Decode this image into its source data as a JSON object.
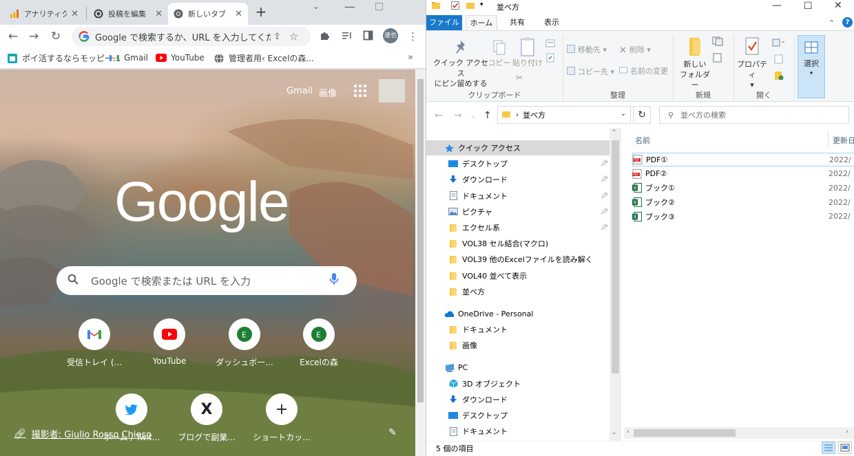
{
  "chrome": {
    "tabs": [
      {
        "label": "アナリティクス",
        "icon": "analytics-icon"
      },
      {
        "label": "投稿を編集",
        "icon": "wordpress-icon"
      },
      {
        "label": "新しいタブ",
        "icon": "chrome-icon",
        "active": true
      }
    ],
    "new_tab_label": "+",
    "omnibox": {
      "placeholder": "Google で検索するか、URL を入力してくださ..."
    },
    "profile_avatar": "遠也",
    "bookmarks": [
      {
        "label": "ポイ活するならモッピー...",
        "icon": "moppy-icon"
      },
      {
        "label": "Gmail",
        "icon": "gmail-icon"
      },
      {
        "label": "YouTube",
        "icon": "youtube-icon"
      },
      {
        "label": "管理者用‹ Excelの森...",
        "icon": "globe-icon"
      }
    ],
    "bookmarks_more": "»",
    "ntp": {
      "gmail_link": "Gmail",
      "images_link": "画像",
      "logo": "Google",
      "search_placeholder": "Google で検索または URL を入力",
      "shortcuts": [
        {
          "label": "受信トレイ (...",
          "icon": "gmail-icon"
        },
        {
          "label": "YouTube",
          "icon": "youtube-icon"
        },
        {
          "label": "ダッシュボー...",
          "icon": "e-letter-icon"
        },
        {
          "label": "Excelの森",
          "icon": "e-letter-icon"
        },
        {
          "label": "ホーム / Twit...",
          "icon": "twitter-icon"
        },
        {
          "label": "ブログで副業...",
          "icon": "x-letter-icon"
        },
        {
          "label": "ショートカッ...",
          "icon": "plus-icon"
        }
      ],
      "photo_credit": "撮影者: Giulio Rosso Chioso"
    }
  },
  "explorer": {
    "window_title": "並べ方",
    "ribbon_tabs": [
      "ファイル",
      "ホーム",
      "共有",
      "表示"
    ],
    "ribbon": {
      "pin_label_1": "クイック アクセス",
      "pin_label_2": "にピン留めする",
      "copy": "コピー",
      "paste": "貼り付け",
      "clipboard_group": "クリップボード",
      "move_to": "移動先",
      "copy_to": "コピー先",
      "delete": "削除",
      "rename": "名前の変更",
      "organize_group": "整理",
      "new_folder_1": "新しい",
      "new_folder_2": "フォルダー",
      "new_group": "新規",
      "properties": "プロパティ",
      "open_group": "開く",
      "select": "選択"
    },
    "address": {
      "path": "並べ方",
      "search_placeholder": "並べ方の検索"
    },
    "nav": [
      {
        "label": "クイック アクセス",
        "icon": "star-icon",
        "level": 0,
        "selected": true
      },
      {
        "label": "デスクトップ",
        "icon": "desktop-icon",
        "level": 1,
        "pinned": true
      },
      {
        "label": "ダウンロード",
        "icon": "download-icon",
        "level": 1,
        "pinned": true
      },
      {
        "label": "ドキュメント",
        "icon": "document-icon",
        "level": 1,
        "pinned": true
      },
      {
        "label": "ピクチャ",
        "icon": "picture-icon",
        "level": 1,
        "pinned": true
      },
      {
        "label": "エクセル系",
        "icon": "folder-icon",
        "level": 1,
        "pinned": true
      },
      {
        "label": "VOL38 セル結合(マクロ)",
        "icon": "folder-icon",
        "level": 1
      },
      {
        "label": "VOL39 他のExcelファイルを読み解く",
        "icon": "folder-icon",
        "level": 1
      },
      {
        "label": "VOL40 並べて表示",
        "icon": "folder-icon",
        "level": 1
      },
      {
        "label": "並べ方",
        "icon": "folder-icon",
        "level": 1
      },
      {
        "label": "OneDrive - Personal",
        "icon": "cloud-icon",
        "level": 0,
        "gap": true
      },
      {
        "label": "ドキュメント",
        "icon": "folder-icon",
        "level": 1
      },
      {
        "label": "画像",
        "icon": "folder-icon",
        "level": 1
      },
      {
        "label": "PC",
        "icon": "pc-icon",
        "level": 0,
        "gap": true
      },
      {
        "label": "3D オブジェクト",
        "icon": "cube-icon",
        "level": 1
      },
      {
        "label": "ダウンロード",
        "icon": "download-icon",
        "level": 1
      },
      {
        "label": "デスクトップ",
        "icon": "desktop-icon",
        "level": 1
      },
      {
        "label": "ドキュメント",
        "icon": "document-icon",
        "level": 1
      }
    ],
    "columns": {
      "name": "名前",
      "modified": "更新日"
    },
    "files": [
      {
        "name": "PDF①",
        "type": "pdf",
        "date": "2022/"
      },
      {
        "name": "PDF②",
        "type": "pdf",
        "date": "2022/"
      },
      {
        "name": "ブック①",
        "type": "xlsx",
        "date": "2022/"
      },
      {
        "name": "ブック②",
        "type": "xlsx",
        "date": "2022/"
      },
      {
        "name": "ブック③",
        "type": "xlsx",
        "date": "2022/"
      }
    ],
    "status": "5 個の項目"
  },
  "colors": {
    "file_tab": "#1979ca",
    "selection": "#cce4f7",
    "chrome_frame": "#dee1e6"
  }
}
